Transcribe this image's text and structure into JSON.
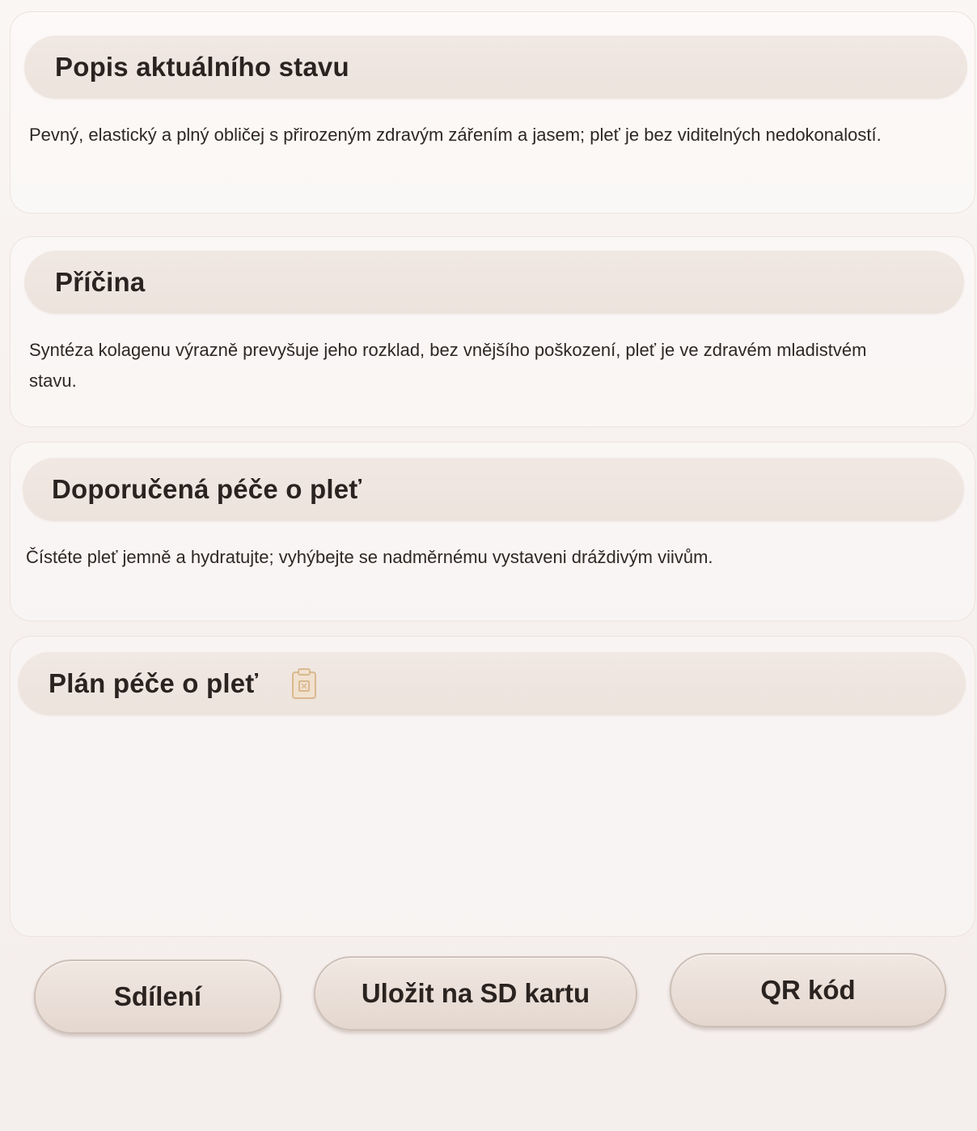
{
  "sections": [
    {
      "title": "Popis aktuálního stavu",
      "body": "Pevný, elastický a plný obličej s přirozeným zdravým zářením a jasem; pleť je bez viditelných nedokonalostí."
    },
    {
      "title": "Příčina",
      "body": "Syntéza kolagenu výrazně prevyšuje jeho rozklad, bez vnějšího poškození, pleť je ve zdravém mladistvém stavu."
    },
    {
      "title": "Doporučená péče o pleť",
      "body": "Čístéte pleť jemně a hydratujte; vyhýbejte se nadměrnému vystaveni dráždivým viivům."
    },
    {
      "title": "Plán péče o pleť",
      "icon": "clipboard-icon"
    }
  ],
  "buttons": {
    "share": "Sdílení",
    "save_sd": "Uložit na SD kartu",
    "qr": "QR kód"
  },
  "colors": {
    "background": "#f7f1ef",
    "header_pill": "#ede3dd",
    "button": "#e9ddd6",
    "icon_accent": "#d9b98f"
  }
}
